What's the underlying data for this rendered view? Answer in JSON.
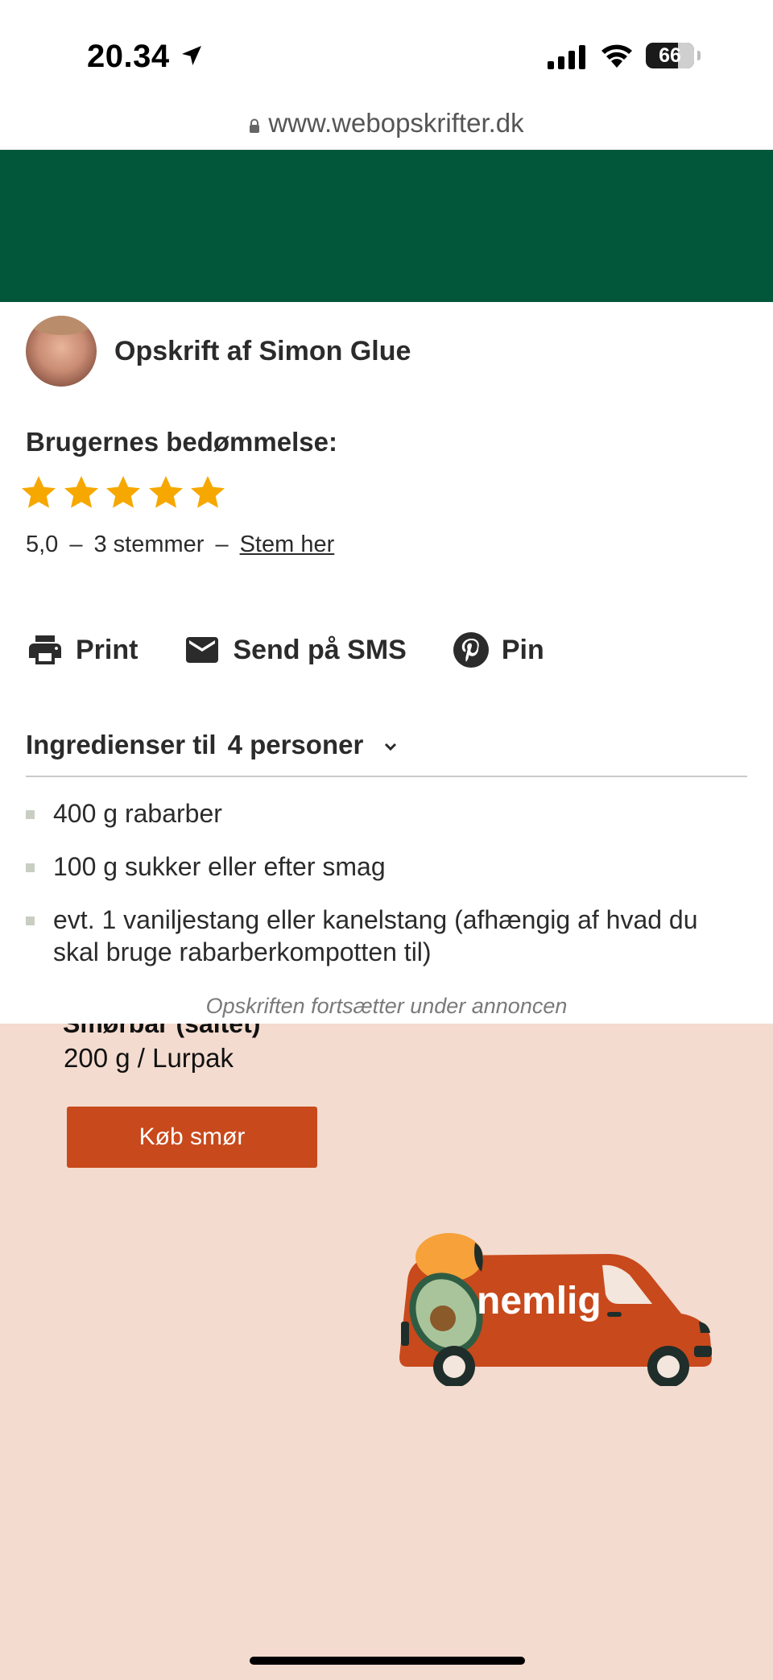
{
  "status_bar": {
    "time": "20.34",
    "battery_level": "66",
    "icons": [
      "location-arrow-icon",
      "cellular-signal-icon",
      "wifi-icon",
      "battery-icon"
    ]
  },
  "browser": {
    "url": "www.webopskrifter.dk",
    "lock_icon": "lock-icon"
  },
  "banner": {
    "color": "#02573a"
  },
  "author": {
    "label": "Opskrift af Simon Glue"
  },
  "rating": {
    "title": "Brugernes bedømmelse:",
    "stars_filled": 5,
    "stars_total": 5,
    "star_color": "#f6a800",
    "score": "5,0",
    "dash1": "–",
    "votes": "3 stemmer",
    "dash2": "–",
    "vote_link": "Stem her"
  },
  "actions": {
    "print": "Print",
    "sms": "Send på SMS",
    "pin": "Pin",
    "icons": [
      "printer-icon",
      "mail-icon",
      "pinterest-icon"
    ]
  },
  "ingredients": {
    "heading": "Ingredienser til",
    "persons": "4 personer",
    "items": [
      "400 g rabarber",
      "100 g sukker eller efter smag",
      "evt. 1 vaniljestang eller kanelstang (afhængig af hvad du skal bruge rabarberkompotten til)"
    ]
  },
  "ad": {
    "notice": "Opskriften fortsætter under annoncen",
    "partial_title": "Smørbar (saltet)",
    "product_size": "200 g / Lurpak",
    "button": "Køb smør",
    "van_logo": "nemlig",
    "background": "#f4dbcf",
    "button_color": "#c8491c"
  }
}
